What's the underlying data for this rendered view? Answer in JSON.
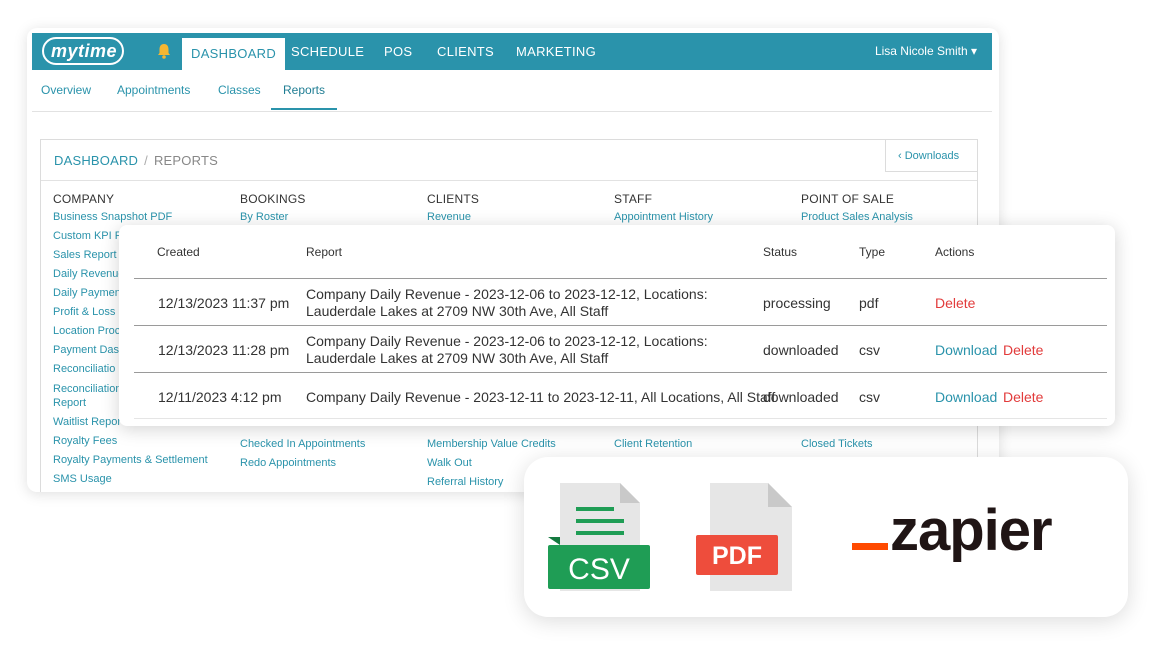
{
  "topbar": {
    "logo": "mytime",
    "nav": [
      {
        "label": "DASHBOARD",
        "active": true
      },
      {
        "label": "SCHEDULE"
      },
      {
        "label": "POS"
      },
      {
        "label": "CLIENTS"
      },
      {
        "label": "MARKETING"
      }
    ],
    "user": "Lisa Nicole Smith ▾",
    "icons": {
      "bell": "bell-icon"
    },
    "colors": {
      "bar": "#2a93ab",
      "bell": "#f5b731"
    }
  },
  "subnav": {
    "tabs": [
      "Overview",
      "Appointments",
      "Classes",
      "Reports"
    ],
    "active": "Reports"
  },
  "breadcrumb": {
    "root": "DASHBOARD",
    "sep": "/",
    "current": "REPORTS"
  },
  "downloads_button": "‹  Downloads",
  "columns": [
    {
      "heading": "COMPANY",
      "links": [
        "Business Snapshot PDF",
        "Custom KPI R",
        "Sales Report E",
        "Daily Revenue",
        "Daily Paymen",
        "Profit & Loss",
        "Location Proc",
        "Payment Dash",
        "Reconciliatio",
        "Reconciliation",
        "Report",
        "Waitlist Repor",
        "Royalty Fees",
        "Royalty Payments & Settlement",
        "SMS Usage"
      ]
    },
    {
      "heading": "BOOKINGS",
      "links": [
        "By Roster",
        "Checked In Appointments",
        "Redo Appointments"
      ]
    },
    {
      "heading": "CLIENTS",
      "links": [
        "Revenue",
        "Membership Value Credits",
        "Walk Out",
        "Referral History"
      ]
    },
    {
      "heading": "STAFF",
      "links": [
        "Appointment History",
        "Client Retention"
      ]
    },
    {
      "heading": "POINT OF SALE",
      "links": [
        "Product Sales Analysis",
        "Closed Tickets"
      ]
    }
  ],
  "downloads": {
    "headers": [
      "Created",
      "Report",
      "Status",
      "Type",
      "Actions"
    ],
    "rows": [
      {
        "created": "12/13/2023 11:37 pm",
        "report": "Company Daily Revenue - 2023-12-06 to 2023-12-12, Locations: Lauderdale Lakes at 2709 NW 30th Ave, All Staff",
        "status": "processing",
        "type": "pdf",
        "download": "",
        "delete": "Delete"
      },
      {
        "created": "12/13/2023 11:28 pm",
        "report": "Company Daily Revenue - 2023-12-06 to 2023-12-12, Locations: Lauderdale Lakes at 2709 NW 30th Ave, All Staff",
        "status": "downloaded",
        "type": "csv",
        "download": "Download",
        "delete": "Delete"
      },
      {
        "created": "12/11/2023 4:12 pm",
        "report": "Company Daily Revenue - 2023-12-11 to 2023-12-11, All Locations, All Staff",
        "status": "downloaded",
        "type": "csv",
        "download": "Download",
        "delete": "Delete"
      }
    ]
  },
  "export": {
    "csv_label": "CSV",
    "pdf_label": "PDF",
    "zapier_label": "zapier",
    "colors": {
      "csv": "#1f9d55",
      "pdf": "#ee4d3c",
      "zapier_dash": "#ff4a00"
    }
  }
}
